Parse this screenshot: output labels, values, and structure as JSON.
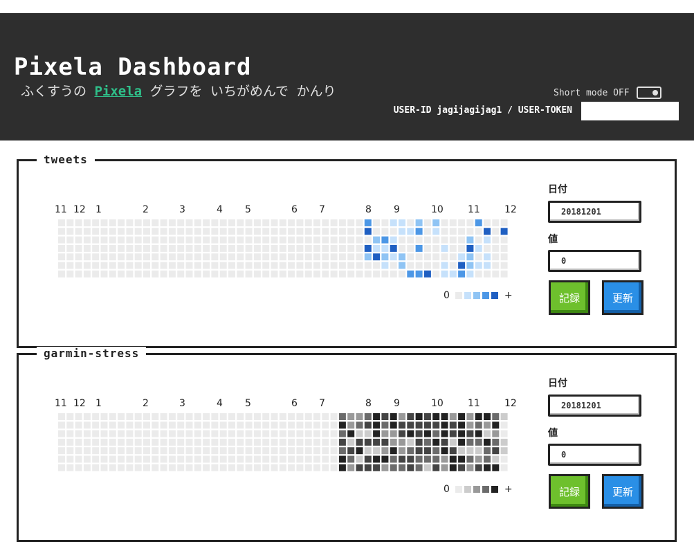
{
  "header": {
    "title": "Pixela Dashboard",
    "subtitle_pre": "ふくすうの ",
    "subtitle_link": "Pixela",
    "subtitle_post": " グラフを いちがめんで かんり",
    "short_mode_label": "Short mode OFF",
    "user_line": "USER-ID  jagijagijag1  / USER-TOKEN"
  },
  "graphs": [
    {
      "name": "tweets",
      "months": [
        "11",
        "12",
        "1",
        "2",
        "3",
        "4",
        "5",
        "6",
        "7",
        "8",
        "9",
        "10",
        "11",
        "12"
      ],
      "date_label": "日付",
      "date_value": "20181201",
      "value_label": "値",
      "value_value": "0",
      "record_button": "記録",
      "update_button": "更新",
      "legend_min": "0",
      "legend_max": "+",
      "palette": [
        "#ebebeb",
        "#c6e1fb",
        "#8fc4f4",
        "#4c97e6",
        "#1f5fc2",
        "#0a3ea0"
      ]
    },
    {
      "name": "garmin-stress",
      "months": [
        "11",
        "12",
        "1",
        "2",
        "3",
        "4",
        "5",
        "6",
        "7",
        "8",
        "9",
        "10",
        "11",
        "12"
      ],
      "date_label": "日付",
      "date_value": "20181201",
      "value_label": "値",
      "value_value": "0",
      "record_button": "記録",
      "update_button": "更新",
      "legend_min": "0",
      "legend_max": "+",
      "palette": [
        "#ebebeb",
        "#cccccc",
        "#999999",
        "#6b6b6b",
        "#444444",
        "#222222"
      ]
    }
  ]
}
